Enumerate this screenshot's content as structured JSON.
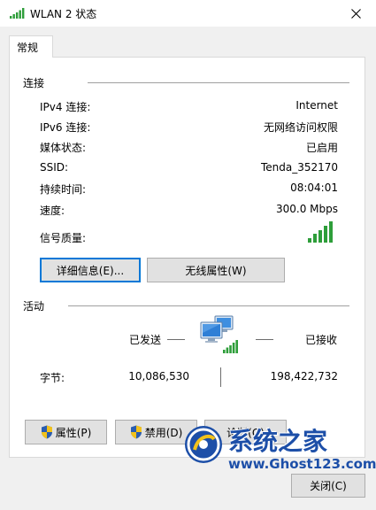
{
  "window": {
    "title": "WLAN 2 状态",
    "close_glyph": "✕"
  },
  "tabs": [
    {
      "label": "常规"
    }
  ],
  "connection": {
    "section_title": "连接",
    "rows": [
      {
        "label": "IPv4 连接:",
        "value": "Internet"
      },
      {
        "label": "IPv6 连接:",
        "value": "无网络访问权限"
      },
      {
        "label": "媒体状态:",
        "value": "已启用"
      },
      {
        "label": "SSID:",
        "value": "Tenda_352170"
      },
      {
        "label": "持续时间:",
        "value": "08:04:01"
      },
      {
        "label": "速度:",
        "value": "300.0 Mbps"
      }
    ],
    "signal_label": "信号质量:",
    "signal_bars": 5,
    "signal_bars_max": 5,
    "details_button": "详细信息(E)...",
    "wireless_props_button": "无线属性(W)"
  },
  "activity": {
    "section_title": "活动",
    "sent_label": "已发送",
    "received_label": "已接收",
    "bytes_label": "字节:",
    "bytes_sent": "10,086,530",
    "bytes_received": "198,422,732"
  },
  "bottom_buttons": {
    "properties": "属性(P)",
    "disable": "禁用(D)",
    "diagnose": "诊断(G)"
  },
  "close_button": "关闭(C)",
  "watermark": {
    "text": "系统之家",
    "url": "www.Ghost123.com"
  },
  "colors": {
    "signal_green": "#2e9e3a",
    "accent_blue": "#0078d7",
    "shield_blue": "#2a5db0",
    "shield_yellow": "#f2c21b"
  }
}
